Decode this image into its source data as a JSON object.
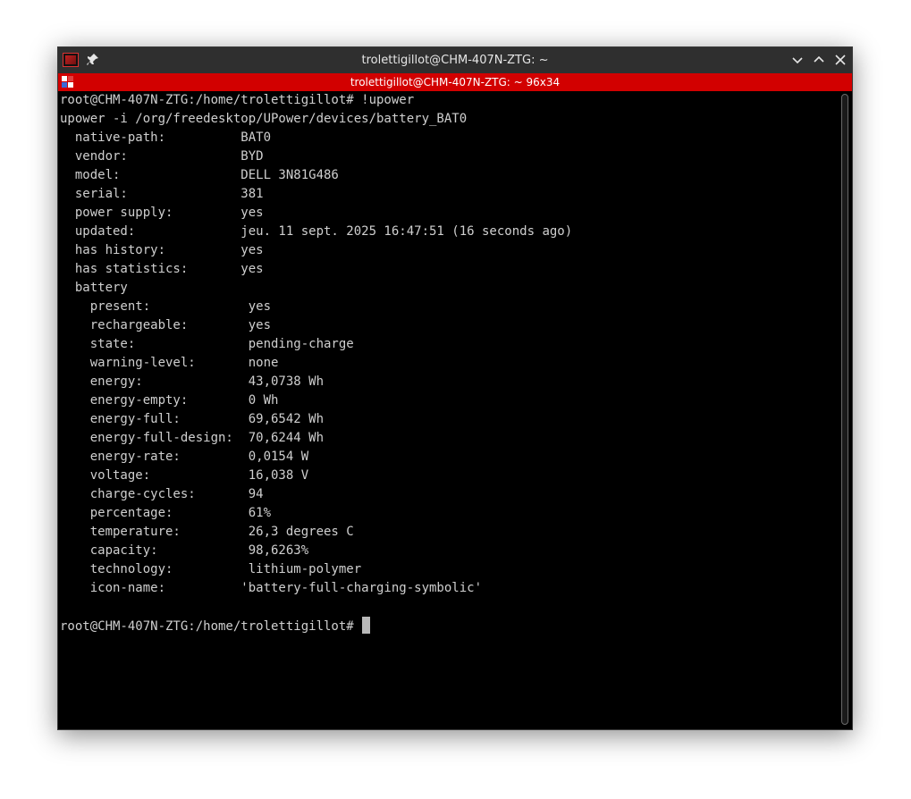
{
  "window": {
    "title": "trolettigillot@CHM-407N-ZTG: ~",
    "tab_title": "trolettigillot@CHM-407N-ZTG: ~ 96x34"
  },
  "terminal": {
    "lines": [
      "root@CHM-407N-ZTG:/home/trolettigillot# !upower",
      "upower -i /org/freedesktop/UPower/devices/battery_BAT0",
      "  native-path:          BAT0",
      "  vendor:               BYD",
      "  model:                DELL 3N81G486",
      "  serial:               381",
      "  power supply:         yes",
      "  updated:              jeu. 11 sept. 2025 16:47:51 (16 seconds ago)",
      "  has history:          yes",
      "  has statistics:       yes",
      "  battery",
      "    present:             yes",
      "    rechargeable:        yes",
      "    state:               pending-charge",
      "    warning-level:       none",
      "    energy:              43,0738 Wh",
      "    energy-empty:        0 Wh",
      "    energy-full:         69,6542 Wh",
      "    energy-full-design:  70,6244 Wh",
      "    energy-rate:         0,0154 W",
      "    voltage:             16,038 V",
      "    charge-cycles:       94",
      "    percentage:          61%",
      "    temperature:         26,3 degrees C",
      "    capacity:            98,6263%",
      "    technology:          lithium-polymer",
      "    icon-name:          'battery-full-charging-symbolic'",
      ""
    ],
    "prompt": "root@CHM-407N-ZTG:/home/trolettigillot#"
  },
  "colors": {
    "tab_bar": "#d20000",
    "title_bar": "#2f2f2f",
    "terminal_bg": "#000000",
    "terminal_fg": "#cfcfcf"
  },
  "icons": {
    "app": "konsole-terminal-icon",
    "pin": "pin-icon",
    "minimize": "chevron-down-icon",
    "maximize": "chevron-up-icon",
    "close": "close-icon",
    "tab": "tab-grid-icon"
  }
}
